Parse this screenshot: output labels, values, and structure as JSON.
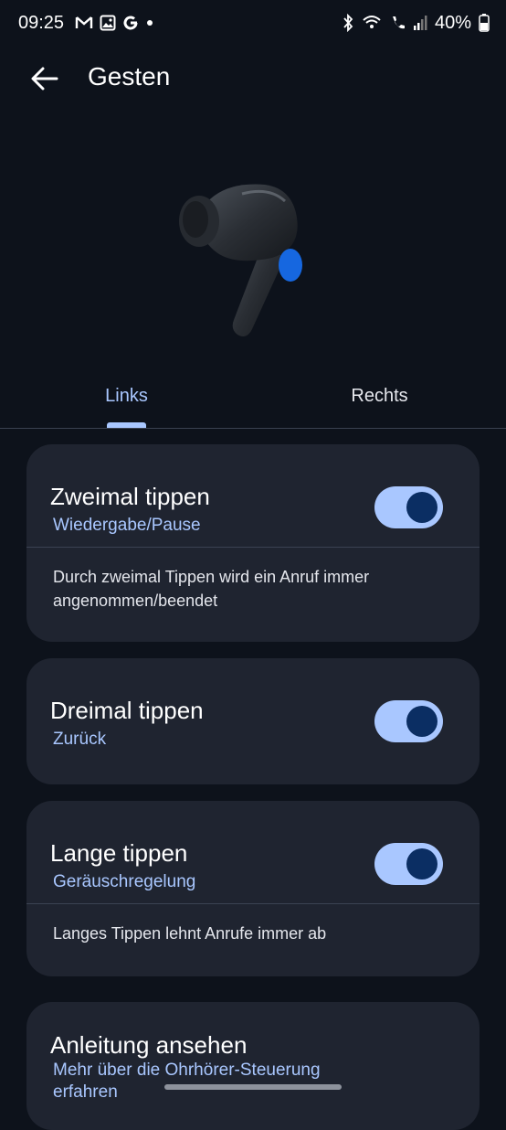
{
  "status_bar": {
    "time": "09:25",
    "battery": "40%",
    "left_icons": [
      "gmail-icon",
      "gallery-icon",
      "google-icon",
      "dot-icon"
    ],
    "right_icons": [
      "bluetooth-icon",
      "wifi-calling-icon",
      "call-icon",
      "signal-icon",
      "battery-icon"
    ]
  },
  "app_bar": {
    "title": "Gesten"
  },
  "tabs": {
    "left": "Links",
    "right": "Rechts",
    "selected": "Links"
  },
  "cards": [
    {
      "title": "Zweimal tippen",
      "subtitle": "Wiedergabe/Pause",
      "toggle_on": true,
      "description": "Durch zweimal Tippen wird ein Anruf immer angenommen/beendet"
    },
    {
      "title": "Dreimal tippen",
      "subtitle": "Zurück",
      "toggle_on": true
    },
    {
      "title": "Lange tippen",
      "subtitle": "Geräuschregelung",
      "toggle_on": true,
      "description": "Langes Tippen lehnt Anrufe immer ab"
    },
    {
      "title": "Anleitung ansehen",
      "subtitle_line1": "Mehr über die Ohrhörer-Steuerung",
      "subtitle_line2": "erfahren"
    }
  ],
  "colors": {
    "background": "#0d121b",
    "card": "#1f2430",
    "accent": "#a9c7ff",
    "toggle_knob": "#0b2e63",
    "earbud_button": "#1667e0"
  }
}
